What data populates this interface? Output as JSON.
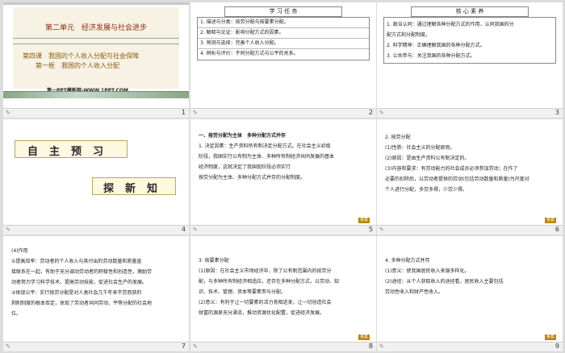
{
  "slides": [
    {
      "number": "1",
      "unit": "第二单元　经济发展与社会进步",
      "chapter": "第四课　我国的个人收入分配与社会保障",
      "section": "第一框　我国的个人收入分配",
      "template": "第一PPT模板网-WWW.1PPT.COM"
    },
    {
      "number": "2",
      "box_title": "学 习 任 务",
      "rows": [
        "1. 描述与分类：按劳分配与按要素分配。",
        "2. 解释与论证：影响分配方式的因素。",
        "3. 预测与选择：完善个人收入分配。",
        "4. 辨析与评价：不同分配方式与公平的关系。"
      ]
    },
    {
      "number": "3",
      "box_title": "核 心 素 养",
      "lines": [
        "1. 政治认同：通过理解各种分配方式的作用，认同我国的分",
        "配方式和分配制度。",
        "2. 科学精神：正确理解我国的各种分配方式。",
        "3. 公共参与：关注我国的各种分配方式。"
      ]
    },
    {
      "number": "4",
      "banner1": "自主预习",
      "banner2": "探新知"
    },
    {
      "number": "5",
      "lines": [
        "一、按劳分配为主体　多种分配方式并存",
        "1. 决定因素：生产资料所有制决定分配方式。在社会主义初级",
        "阶段，我国实行公有制为主体、多种所有制经济共同发展的基本",
        "经济制度，这就决定了我国现阶段必须实行",
        "按劳分配为主体、多种分配方式并存的分配制度。"
      ],
      "tag": "答案"
    },
    {
      "number": "6",
      "lines": [
        "2. 按劳分配",
        "(1)性质：社会主义的分配原则。",
        "(2)原因：是由生产资料公有制决定的。",
        "(3)内容和要求：有劳动能力的社会成员必须参加劳动；在作了",
        "必要的扣除后，以劳动者提供的劳动(包括劳动数量和质量)为尺度对",
        "个人进行分配，多劳多得，少劳少得。"
      ],
      "tag": "答案"
    },
    {
      "number": "7",
      "lines": [
        "(4)作用",
        "①提高效率：劳动者的个人收入与其付出的劳动数量和质量直",
        "接联系在一起，有助于充分调动劳动者的积极性和创造性，激励劳",
        "动者努力学习科学技术、提高劳动技能，促进社会生产的发展。",
        "②体现公平：实行按劳分配是对人类社会几千年来不劳而获的",
        "剥削制度的根本否定，体现了劳动者共同劳动、平等分配的社会地",
        "位。"
      ]
    },
    {
      "number": "8",
      "lines": [
        "3. 按要素分配",
        "(1)原因：在社会主义市场经济中，除了公有制范围内的按劳分",
        "配，与多种所有制经济相适应，还存在多种分配方式，以劳动、知",
        "识、技术、管理、资本等要素参与分配。",
        "(2)意义：有利于让一切要素的活力竞相迸发，让一切创造社会",
        "财富的源泉充分涌流，推动资源优化配置，促进经济发展。"
      ],
      "tag": "答案"
    },
    {
      "number": "9",
      "lines": [
        "4. 多种分配方式并存",
        "(1)意义：使我国居民收入来源多样化。",
        "(2)途径：从个人获取收入的途径看，居民收入主要包括",
        "劳动性收入和财产性收入。"
      ],
      "tag": "答案"
    }
  ],
  "footer_icon": "note-icon"
}
